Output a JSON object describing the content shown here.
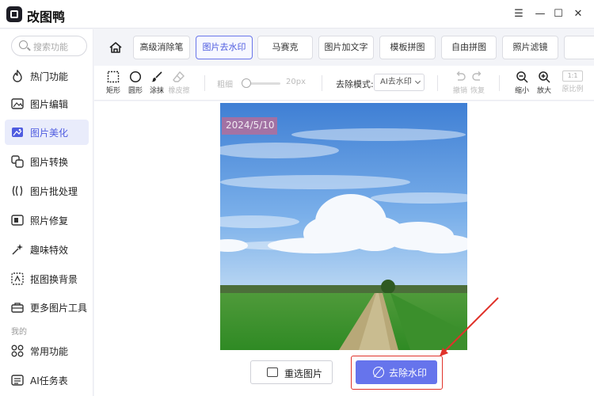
{
  "app": {
    "title": "改图鸭"
  },
  "window_controls": {
    "menu": "☰",
    "minimize": "—",
    "maximize": "☐",
    "close": "✕"
  },
  "sidebar": {
    "search_placeholder": "搜索功能",
    "items": [
      {
        "label": "热门功能",
        "icon": "fire-icon"
      },
      {
        "label": "图片编辑",
        "icon": "image-edit-icon"
      },
      {
        "label": "图片美化",
        "icon": "image-beautify-icon",
        "active": true
      },
      {
        "label": "图片转换",
        "icon": "convert-icon"
      },
      {
        "label": "图片批处理",
        "icon": "batch-icon"
      },
      {
        "label": "照片修复",
        "icon": "photo-repair-icon"
      },
      {
        "label": "趣味特效",
        "icon": "effects-icon"
      },
      {
        "label": "抠图换背景",
        "icon": "cutout-icon"
      },
      {
        "label": "更多图片工具",
        "icon": "toolbox-icon"
      }
    ],
    "section_label": "我的",
    "my_items": [
      {
        "label": "常用功能",
        "icon": "grid-icon"
      },
      {
        "label": "AI任务表",
        "icon": "ai-task-icon"
      }
    ]
  },
  "tabs": [
    {
      "label": "高级消除笔"
    },
    {
      "label": "图片去水印",
      "active": true
    },
    {
      "label": "马赛克"
    },
    {
      "label": "图片加文字"
    },
    {
      "label": "模板拼图"
    },
    {
      "label": "自由拼图"
    },
    {
      "label": "照片滤镜"
    },
    {
      "label": ""
    }
  ],
  "toolbar": {
    "rect": "矩形",
    "circle": "圆形",
    "brush": "涂抹",
    "eraser": "橡皮擦",
    "thickness_label": "粗细",
    "thickness_value": "20px",
    "mode_label": "去除模式:",
    "mode_value": "AI去水印",
    "undo": "撤销",
    "redo": "恢复",
    "zoom_out": "缩小",
    "zoom_in": "放大",
    "ratio_box": "1:1",
    "ratio_label": "原比例"
  },
  "canvas": {
    "watermark_text": "2024/5/10",
    "reselect_label": "重选图片",
    "remove_label": "去除水印"
  }
}
